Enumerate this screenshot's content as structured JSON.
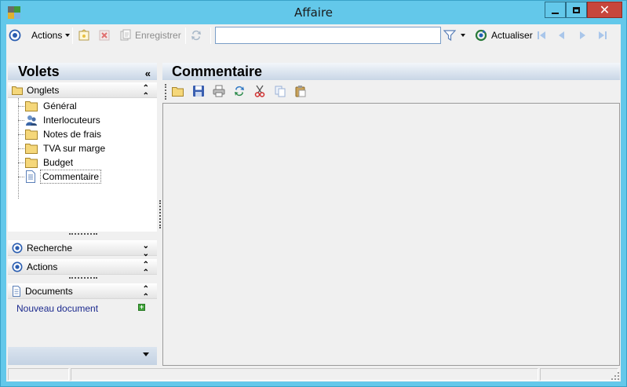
{
  "window": {
    "title": "Affaire",
    "close_glyph": "✕"
  },
  "toolbar": {
    "actions_label": "Actions",
    "save_label": "Enregistrer",
    "search_value": "",
    "refresh_label": "Actualiser"
  },
  "volets": {
    "title": "Volets",
    "collapse_glyph": "«",
    "onglets": {
      "label": "Onglets",
      "items": [
        {
          "label": "Général",
          "icon": "folder-icon"
        },
        {
          "label": "Interlocuteurs",
          "icon": "people-icon"
        },
        {
          "label": "Notes de frais",
          "icon": "folder-icon"
        },
        {
          "label": "TVA sur marge",
          "icon": "folder-icon"
        },
        {
          "label": "Budget",
          "icon": "folder-icon"
        },
        {
          "label": "Commentaire",
          "icon": "document-icon",
          "selected": true
        }
      ]
    },
    "recherche_label": "Recherche",
    "actions_label": "Actions",
    "documents": {
      "label": "Documents",
      "new_document": "Nouveau document",
      "plus_glyph": "+"
    },
    "chevron_up": "⌃",
    "chevron_down": "⌄"
  },
  "content": {
    "title": "Commentaire"
  },
  "colors": {
    "title_bar": "#63c8ea",
    "close_button": "#c7463c",
    "header_gradient": "#c8d6e6",
    "accent_blue": "#1c5fb5",
    "link": "#1c2a8e"
  }
}
